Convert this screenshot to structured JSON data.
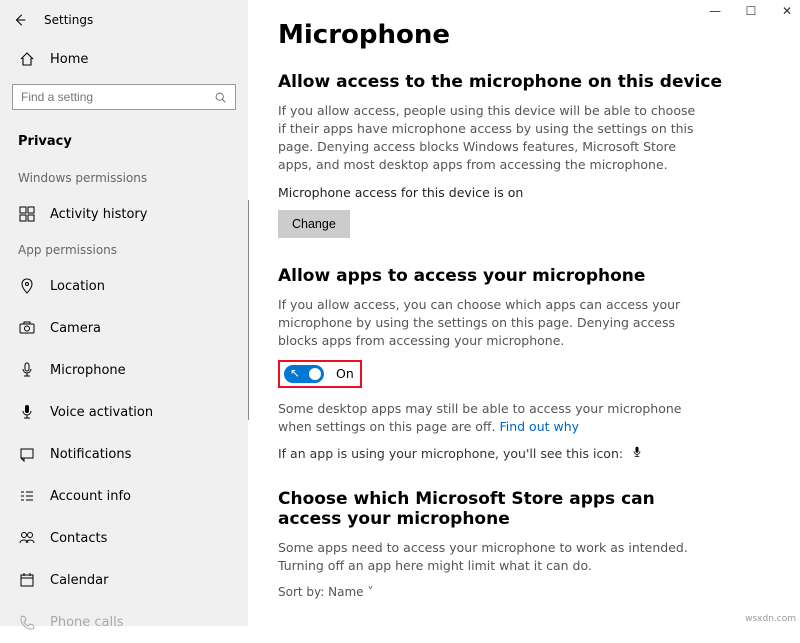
{
  "window": {
    "title": "Settings"
  },
  "home": {
    "label": "Home"
  },
  "search": {
    "placeholder": "Find a setting"
  },
  "category": "Privacy",
  "section_windows": "Windows permissions",
  "section_apps": "App permissions",
  "nav": {
    "activity": "Activity history",
    "location": "Location",
    "camera": "Camera",
    "microphone": "Microphone",
    "voice": "Voice activation",
    "notifications": "Notifications",
    "account": "Account info",
    "contacts": "Contacts",
    "calendar": "Calendar",
    "phone": "Phone calls"
  },
  "page": {
    "title": "Microphone",
    "s1_heading": "Allow access to the microphone on this device",
    "s1_body": "If you allow access, people using this device will be able to choose if their apps have microphone access by using the settings on this page. Denying access blocks Windows features, Microsoft Store apps, and most desktop apps from accessing the microphone.",
    "s1_status": "Microphone access for this device is on",
    "change_btn": "Change",
    "s2_heading": "Allow apps to access your microphone",
    "s2_body": "If you allow access, you can choose which apps can access your microphone by using the settings on this page. Denying access blocks apps from accessing your microphone.",
    "toggle_label": "On",
    "s2_note_a": "Some desktop apps may still be able to access your microphone when settings on this page are off. ",
    "s2_link": "Find out why",
    "s2_icon_line": "If an app is using your microphone, you'll see this icon:",
    "s3_heading": "Choose which Microsoft Store apps can access your microphone",
    "s3_body": "Some apps need to access your microphone to work as intended. Turning off an app here might limit what it can do.",
    "sort_label": "Sort by:",
    "sort_value": "Name"
  },
  "watermark": "wsxdn.com"
}
